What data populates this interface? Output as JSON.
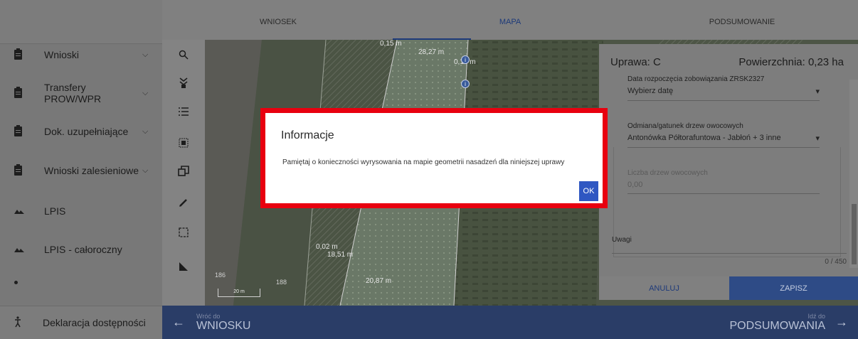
{
  "sidebar": {
    "items": [
      {
        "label": "Wnioski",
        "icon": "document-icon",
        "expandable": true
      },
      {
        "label": "Transfery PROW/WPR",
        "icon": "document-icon",
        "expandable": true
      },
      {
        "label": "Dok. uzupełniające",
        "icon": "document-icon",
        "expandable": true
      },
      {
        "label": "Wnioski zalesieniowe",
        "icon": "document-icon",
        "expandable": true
      },
      {
        "label": "LPIS",
        "icon": "mountain-icon",
        "expandable": false
      },
      {
        "label": "LPIS - całoroczny",
        "icon": "mountain-icon",
        "expandable": false
      }
    ],
    "footer_label": "Deklaracja dostępności"
  },
  "tabs": [
    {
      "label": "WNIOSEK",
      "active": false
    },
    {
      "label": "MAPA",
      "active": true
    },
    {
      "label": "PODSUMOWANIE",
      "active": false
    }
  ],
  "map": {
    "tools": [
      "search-icon",
      "layers-icon",
      "list-icon",
      "select-area-icon",
      "copy-icon",
      "pencil-icon",
      "rectangle-select-icon",
      "measure-icon"
    ],
    "scale_label": "20 m",
    "measurements": [
      "0,15 m",
      "28,27 m",
      "0,15 m",
      "0,02 m",
      "18,51 m",
      "20,87 m"
    ],
    "plot_numbers": [
      "186",
      "188"
    ]
  },
  "panel": {
    "crop_label": "Uprawa: C",
    "area_label": "Powierzchnia: 0,23 ha",
    "start_date_label": "Data rozpoczęcia zobowiązania ZRSK2327",
    "start_date_value": "Wybierz datę",
    "variety_label": "Odmiana/gatunek drzew owocowych",
    "variety_value": "Antonówka Półtorafuntowa - Jabłoń + 3 inne",
    "tree_count_label": "Liczba drzew owocowych",
    "tree_count_value": "0,00",
    "notes_label": "Uwagi",
    "notes_counter": "0 / 450",
    "cancel_label": "ANULUJ",
    "save_label": "ZAPISZ"
  },
  "navbar": {
    "back_sub": "Wróć do",
    "back_main": "WNIOSKU",
    "next_sub": "Idź do",
    "next_main": "PODSUMOWANIA"
  },
  "dialog": {
    "title": "Informacje",
    "message": "Pamiętaj o konieczności wyrysowania na mapie geometrii nasadzeń dla niniejszej uprawy",
    "ok_label": "OK"
  }
}
